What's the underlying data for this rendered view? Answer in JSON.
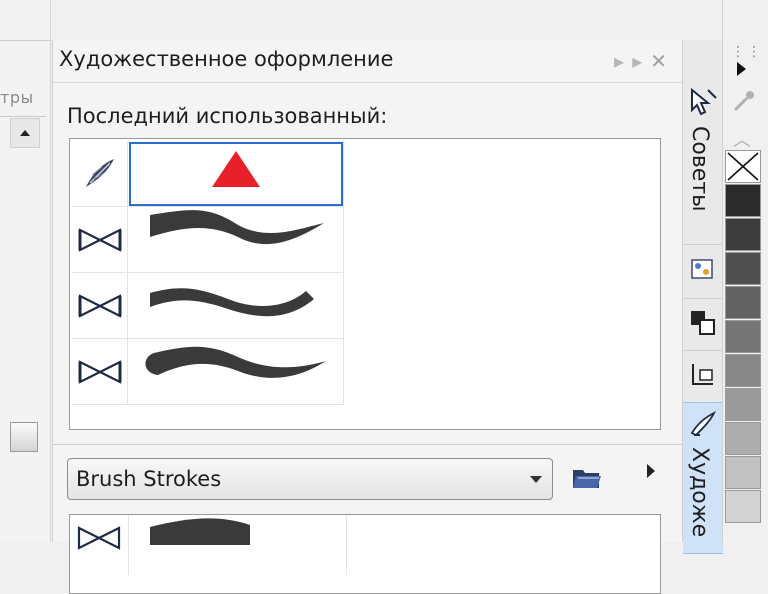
{
  "left_panel": {
    "partial_label": "тры"
  },
  "panel": {
    "title": "Художественное оформление",
    "recent_label": "Последний использованный:",
    "dropdown_value": "Brush Strokes"
  },
  "side_tabs": [
    {
      "label": "Советы",
      "active": false
    },
    {
      "label": "Художе",
      "active": true
    }
  ],
  "icons": {
    "title_buttons": [
      "double-arrow-right-icon",
      "close-icon"
    ],
    "recent_row_icons": [
      "feather-brush-icon",
      "bowtie-stroke-icon",
      "bowtie-stroke-icon",
      "bowtie-stroke-icon"
    ],
    "side_tab_icons": [
      "hints-cursor-icon",
      "color-palette-icon",
      "transform-icon",
      "dimension-icon",
      "artistic-media-icon"
    ]
  },
  "colors": {
    "selection_border": "#2a6ed0",
    "red_triangle": "#e8202a",
    "stroke_fill": "#3a3a3a",
    "active_tab": "#cfe2f7",
    "palette_grays": [
      "#2b2b2b",
      "#3d3d3d",
      "#505050",
      "#626262",
      "#757575",
      "#878787",
      "#9a9a9a",
      "#adadad",
      "#c1c1c1",
      "#d3d3d3"
    ]
  }
}
